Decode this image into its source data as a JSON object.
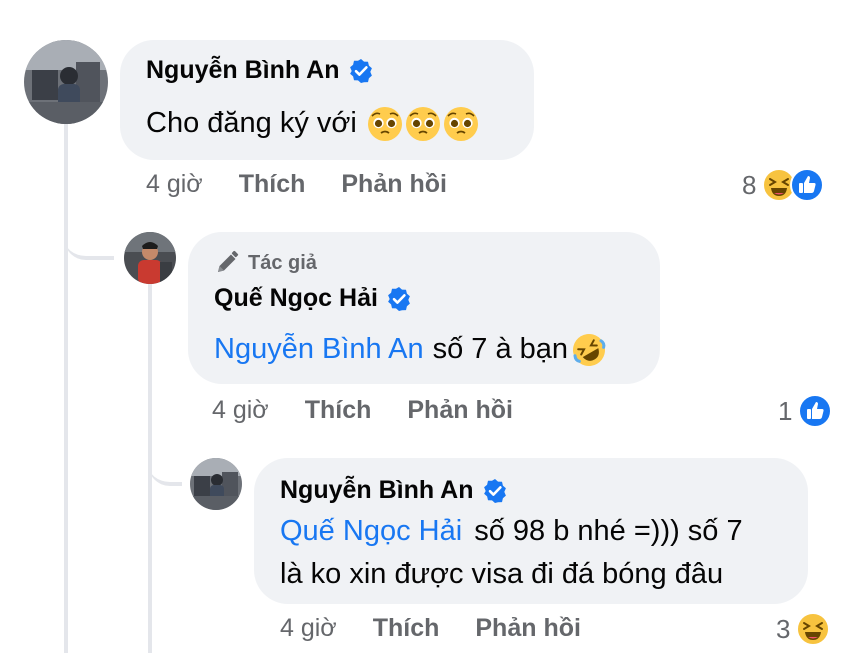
{
  "comments": [
    {
      "author": "Nguyễn Bình An",
      "text": "Cho đăng ký với",
      "time": "4 giờ",
      "like_label": "Thích",
      "reply_label": "Phản hồi",
      "reaction_count": "8",
      "reactions": [
        "laughing-emoji",
        "like-icon"
      ],
      "text_emojis": [
        "pleading-face-emoji",
        "pleading-face-emoji",
        "pleading-face-emoji"
      ]
    },
    {
      "badge": "Tác giả",
      "author": "Quế Ngọc Hải",
      "mention": "Nguyễn Bình An",
      "text": "số 7 à bạn",
      "time": "4 giờ",
      "like_label": "Thích",
      "reply_label": "Phản hồi",
      "reaction_count": "1",
      "reactions": [
        "like-icon"
      ],
      "text_emojis": [
        "rolling-on-floor-laughing-emoji"
      ]
    },
    {
      "author": "Nguyễn Bình An",
      "mention": "Quế Ngọc Hải",
      "text_line1": "số 98 b nhé =))) số 7",
      "text_line2": "là ko xin được visa đi đá bóng đâu",
      "time": "4 giờ",
      "like_label": "Thích",
      "reply_label": "Phản hồi",
      "reaction_count": "3",
      "reactions": [
        "laughing-emoji"
      ]
    }
  ],
  "colors": {
    "bubble": "#f0f2f5",
    "mention": "#1877f2",
    "meta": "#65676b",
    "verified": "#1877f2",
    "thread_line": "#e4e6eb"
  }
}
